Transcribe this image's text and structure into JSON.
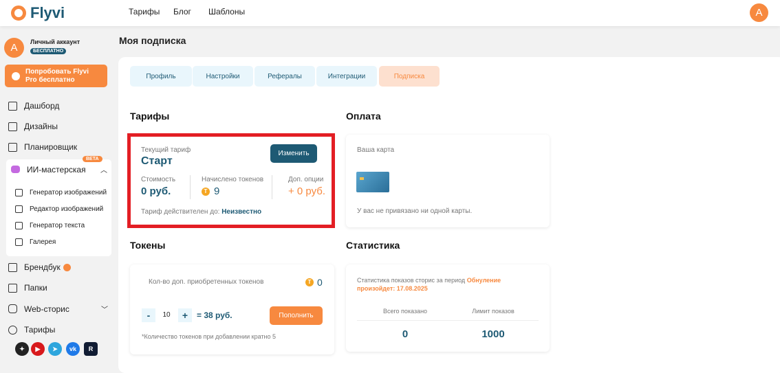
{
  "header": {
    "logo": "Flyvi",
    "nav": [
      "Тарифы",
      "Блог",
      "Шаблоны"
    ],
    "avatar": "A"
  },
  "sidebar": {
    "account": {
      "avatar": "A",
      "name": "Личный аккаунт",
      "badge": "БЕСПЛАТНО"
    },
    "pro_button": "Попробовать Flyvi Pro бесплатно",
    "items": [
      {
        "label": "Дашборд",
        "icon": "grid-icon"
      },
      {
        "label": "Дизайны",
        "icon": "designs-icon"
      },
      {
        "label": "Планировщик",
        "icon": "calendar-icon"
      }
    ],
    "ai": {
      "label": "ИИ-мастерская",
      "badge": "BETA",
      "subitems": [
        "Генератор изображений",
        "Редактор изображений",
        "Генератор текста",
        "Галерея"
      ]
    },
    "items2": [
      {
        "label": "Брендбук",
        "icon": "edit-icon"
      },
      {
        "label": "Папки",
        "icon": "folder-icon"
      },
      {
        "label": "Web-сторис",
        "icon": "instagram-icon"
      },
      {
        "label": "Тарифы",
        "icon": "dollar-icon"
      }
    ],
    "socials": [
      "zen",
      "youtube",
      "telegram",
      "vk",
      "rutube"
    ]
  },
  "page": {
    "title": "Моя подписка",
    "tabs": [
      "Профиль",
      "Настройки",
      "Рефералы",
      "Интеграции",
      "Подписка"
    ],
    "active_tab": "Подписка"
  },
  "tariffs": {
    "heading": "Тарифы",
    "current_label": "Текущий тариф",
    "current": "Старт",
    "change": "Изменить",
    "cost_label": "Стоимость",
    "cost": "0 руб.",
    "tokens_label": "Начислено токенов",
    "tokens": "9",
    "options_label": "Доп. опции",
    "options": "+ 0 руб.",
    "valid_label": "Тариф действителен до:",
    "valid": "Неизвестно"
  },
  "payment": {
    "heading": "Оплата",
    "card_label": "Ваша карта",
    "no_card": "У вас не привязано ни одной карты."
  },
  "tokens": {
    "heading": "Токены",
    "bought_label": "Кол-во доп. приобретенных токенов",
    "bought": "0",
    "minus": "-",
    "qty": "10",
    "plus": "+",
    "price": "= 38 руб.",
    "topup": "Пополнить",
    "note": "*Количество токенов при добавлении кратно 5"
  },
  "stats": {
    "heading": "Статистика",
    "desc": "Статистика показов сторис за период",
    "reset": "Обнуление произойдет: 17.08.2025",
    "total_label": "Всего показано",
    "total": "0",
    "limit_label": "Лимит показов",
    "limit": "1000"
  },
  "colors": {
    "accent": "#f7893f",
    "primary": "#1e5a74",
    "highlight": "#e31e24"
  }
}
